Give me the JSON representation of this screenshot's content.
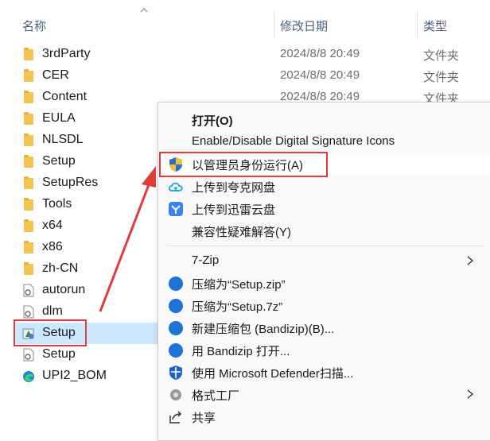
{
  "header": {
    "col_name": "名称",
    "col_date": "修改日期",
    "col_type": "类型"
  },
  "files": [
    {
      "name": "3rdParty",
      "date": "2024/8/8 20:49",
      "type": "文件夹",
      "icon": "folder-icon"
    },
    {
      "name": "CER",
      "date": "2024/8/8 20:49",
      "type": "文件夹",
      "icon": "folder-icon"
    },
    {
      "name": "Content",
      "date": "2024/8/8 20:49",
      "type": "文件夹",
      "icon": "folder-icon"
    },
    {
      "name": "EULA",
      "date": "",
      "type": "",
      "icon": "folder-icon"
    },
    {
      "name": "NLSDL",
      "date": "",
      "type": "",
      "icon": "folder-icon"
    },
    {
      "name": "Setup",
      "date": "",
      "type": "",
      "icon": "folder-icon"
    },
    {
      "name": "SetupRes",
      "date": "",
      "type": "",
      "icon": "folder-icon"
    },
    {
      "name": "Tools",
      "date": "",
      "type": "",
      "icon": "folder-icon"
    },
    {
      "name": "x64",
      "date": "",
      "type": "",
      "icon": "folder-icon"
    },
    {
      "name": "x86",
      "date": "",
      "type": "",
      "icon": "folder-icon"
    },
    {
      "name": "zh-CN",
      "date": "",
      "type": "",
      "icon": "folder-icon"
    },
    {
      "name": "autorun",
      "date": "",
      "type": "",
      "icon": "settings-file-icon"
    },
    {
      "name": "dlm",
      "date": "",
      "type": "",
      "icon": "settings-file-icon"
    },
    {
      "name": "Setup",
      "date": "",
      "type": "",
      "icon": "setup-exe-icon"
    },
    {
      "name": "Setup",
      "date": "",
      "type": "",
      "icon": "settings-file-icon"
    },
    {
      "name": "UPI2_BOM",
      "date": "",
      "type": "",
      "icon": "edge-icon"
    }
  ],
  "context_menu": {
    "open": "打开(O)",
    "signature_icons": "Enable/Disable Digital Signature Icons",
    "run_as_admin": "以管理员身份运行(A)",
    "upload_quark": "上传到夸克网盘",
    "upload_xunlei": "上传到迅雷云盘",
    "compat_troubleshoot": "兼容性疑难解答(Y)",
    "seven_zip": "7-Zip",
    "compress_zip": "压缩为“Setup.zip”",
    "compress_7z": "压缩为“Setup.7z”",
    "new_archive": "新建压缩包 (Bandizip)(B)...",
    "open_bandizip": "用 Bandizip 打开...",
    "defender_scan": "使用 Microsoft Defender扫描...",
    "format_factory": "格式工厂",
    "share": "共享"
  },
  "colors": {
    "selection": "#cce8ff",
    "annotation_red": "#e13c3c",
    "folder_yellow": "#f3c451",
    "header_text": "#4c607a"
  }
}
